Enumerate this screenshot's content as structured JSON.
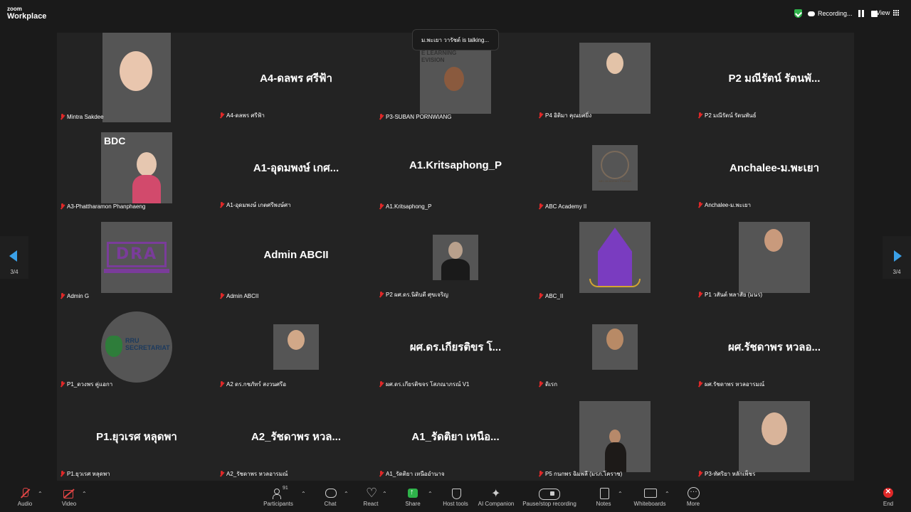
{
  "app": {
    "logo_line1": "zoom",
    "logo_line2": "Workplace"
  },
  "recording": {
    "label": "Recording..."
  },
  "view_button": {
    "label": "View"
  },
  "speaker_indicator": "ม.พะเยา วารัชต์ is talking...",
  "pagination": {
    "left": "3/4",
    "right": "3/4"
  },
  "tiles": [
    {
      "name": "Mintra Sakdee",
      "big": ""
    },
    {
      "name": "A4-ดลพร ศรีฟ้า",
      "big": "A4-ดลพร ศรีฟ้า"
    },
    {
      "name": "P3-SUBAN PORNWIANG",
      "big": "",
      "video_text": "E LEARNING\nEVISION"
    },
    {
      "name": "P4 อิติมา คุณยศยิ่ง",
      "big": ""
    },
    {
      "name": "P2 มณีรัตน์ รัตนพันธ์",
      "big": "P2 มณีรัตน์ รัตนพั..."
    },
    {
      "name": "A3-Phattharamon Phanphaeng",
      "big": "",
      "video_text": "BDC"
    },
    {
      "name": "A1-อุดมพงษ์ เกตศรีพงษ์ศา",
      "big": "A1-อุดมพงษ์ เกศ..."
    },
    {
      "name": "A1.Kritsaphong_P",
      "big": "A1.Kritsaphong_P"
    },
    {
      "name": "ABC Academy II",
      "big": "",
      "video_text": "ABC ACADEMY PHAYAO"
    },
    {
      "name": "Anchalee-ม.พะเยา",
      "big": "Anchalee-ม.พะเยา"
    },
    {
      "name": "Admin G",
      "big": "",
      "video_text": "DRA"
    },
    {
      "name": "Admin ABCII",
      "big": "Admin ABCII"
    },
    {
      "name": "P2 ผศ.ดร.นิติบดี ศุขเจริญ",
      "big": ""
    },
    {
      "name": "ABC_II",
      "big": ""
    },
    {
      "name": "P1 วสันต์ พลาสัย (มนร)",
      "big": ""
    },
    {
      "name": "P1_ดวงพร คู่แอกา",
      "big": "",
      "video_text": "RRU\nSECRETARIAT"
    },
    {
      "name": "A2 ดร.กชภัทร์ สงวนศรีอ",
      "big": ""
    },
    {
      "name": "ผศ.ดร.เกียรติขจร โสภณาภรณ์ V1",
      "big": "ผศ.ดร.เกียรติขร โ..."
    },
    {
      "name": "ดิเรก",
      "big": ""
    },
    {
      "name": "ผศ.รัชดาพร หวลอารมณ์",
      "big": "ผศ.รัชดาพร หวลอ..."
    },
    {
      "name": "P1.ยุวเรศ หลุดพา",
      "big": "P1.ยุวเรศ หลุดพา"
    },
    {
      "name": "A2_รัชดาพร หวลอารมณ์",
      "big": "A2_รัชดาพร หวล..."
    },
    {
      "name": "A1_รัดติยา เหนืออำนาจ",
      "big": "A1_รัดติยา เหนือ..."
    },
    {
      "name": "P5 กนกพร ฉิมพลี (มรภ.โคราช)",
      "big": ""
    },
    {
      "name": "P3-ทัศริยา หลักเพ็ชร",
      "big": ""
    }
  ],
  "toolbar": {
    "audio": "Audio",
    "video": "Video",
    "participants": "Participants",
    "participants_count": "91",
    "chat": "Chat",
    "react": "React",
    "share": "Share",
    "host_tools": "Host tools",
    "ai_companion": "AI Companion",
    "pause_stop": "Pause/stop recording",
    "notes": "Notes",
    "whiteboards": "Whiteboards",
    "more": "More",
    "end": "End"
  },
  "colors": {
    "accent_blue": "#3aa0e8",
    "green": "#2eb34a",
    "red": "#e02828",
    "background": "#1a1a1a",
    "tile_bg": "#232323"
  }
}
